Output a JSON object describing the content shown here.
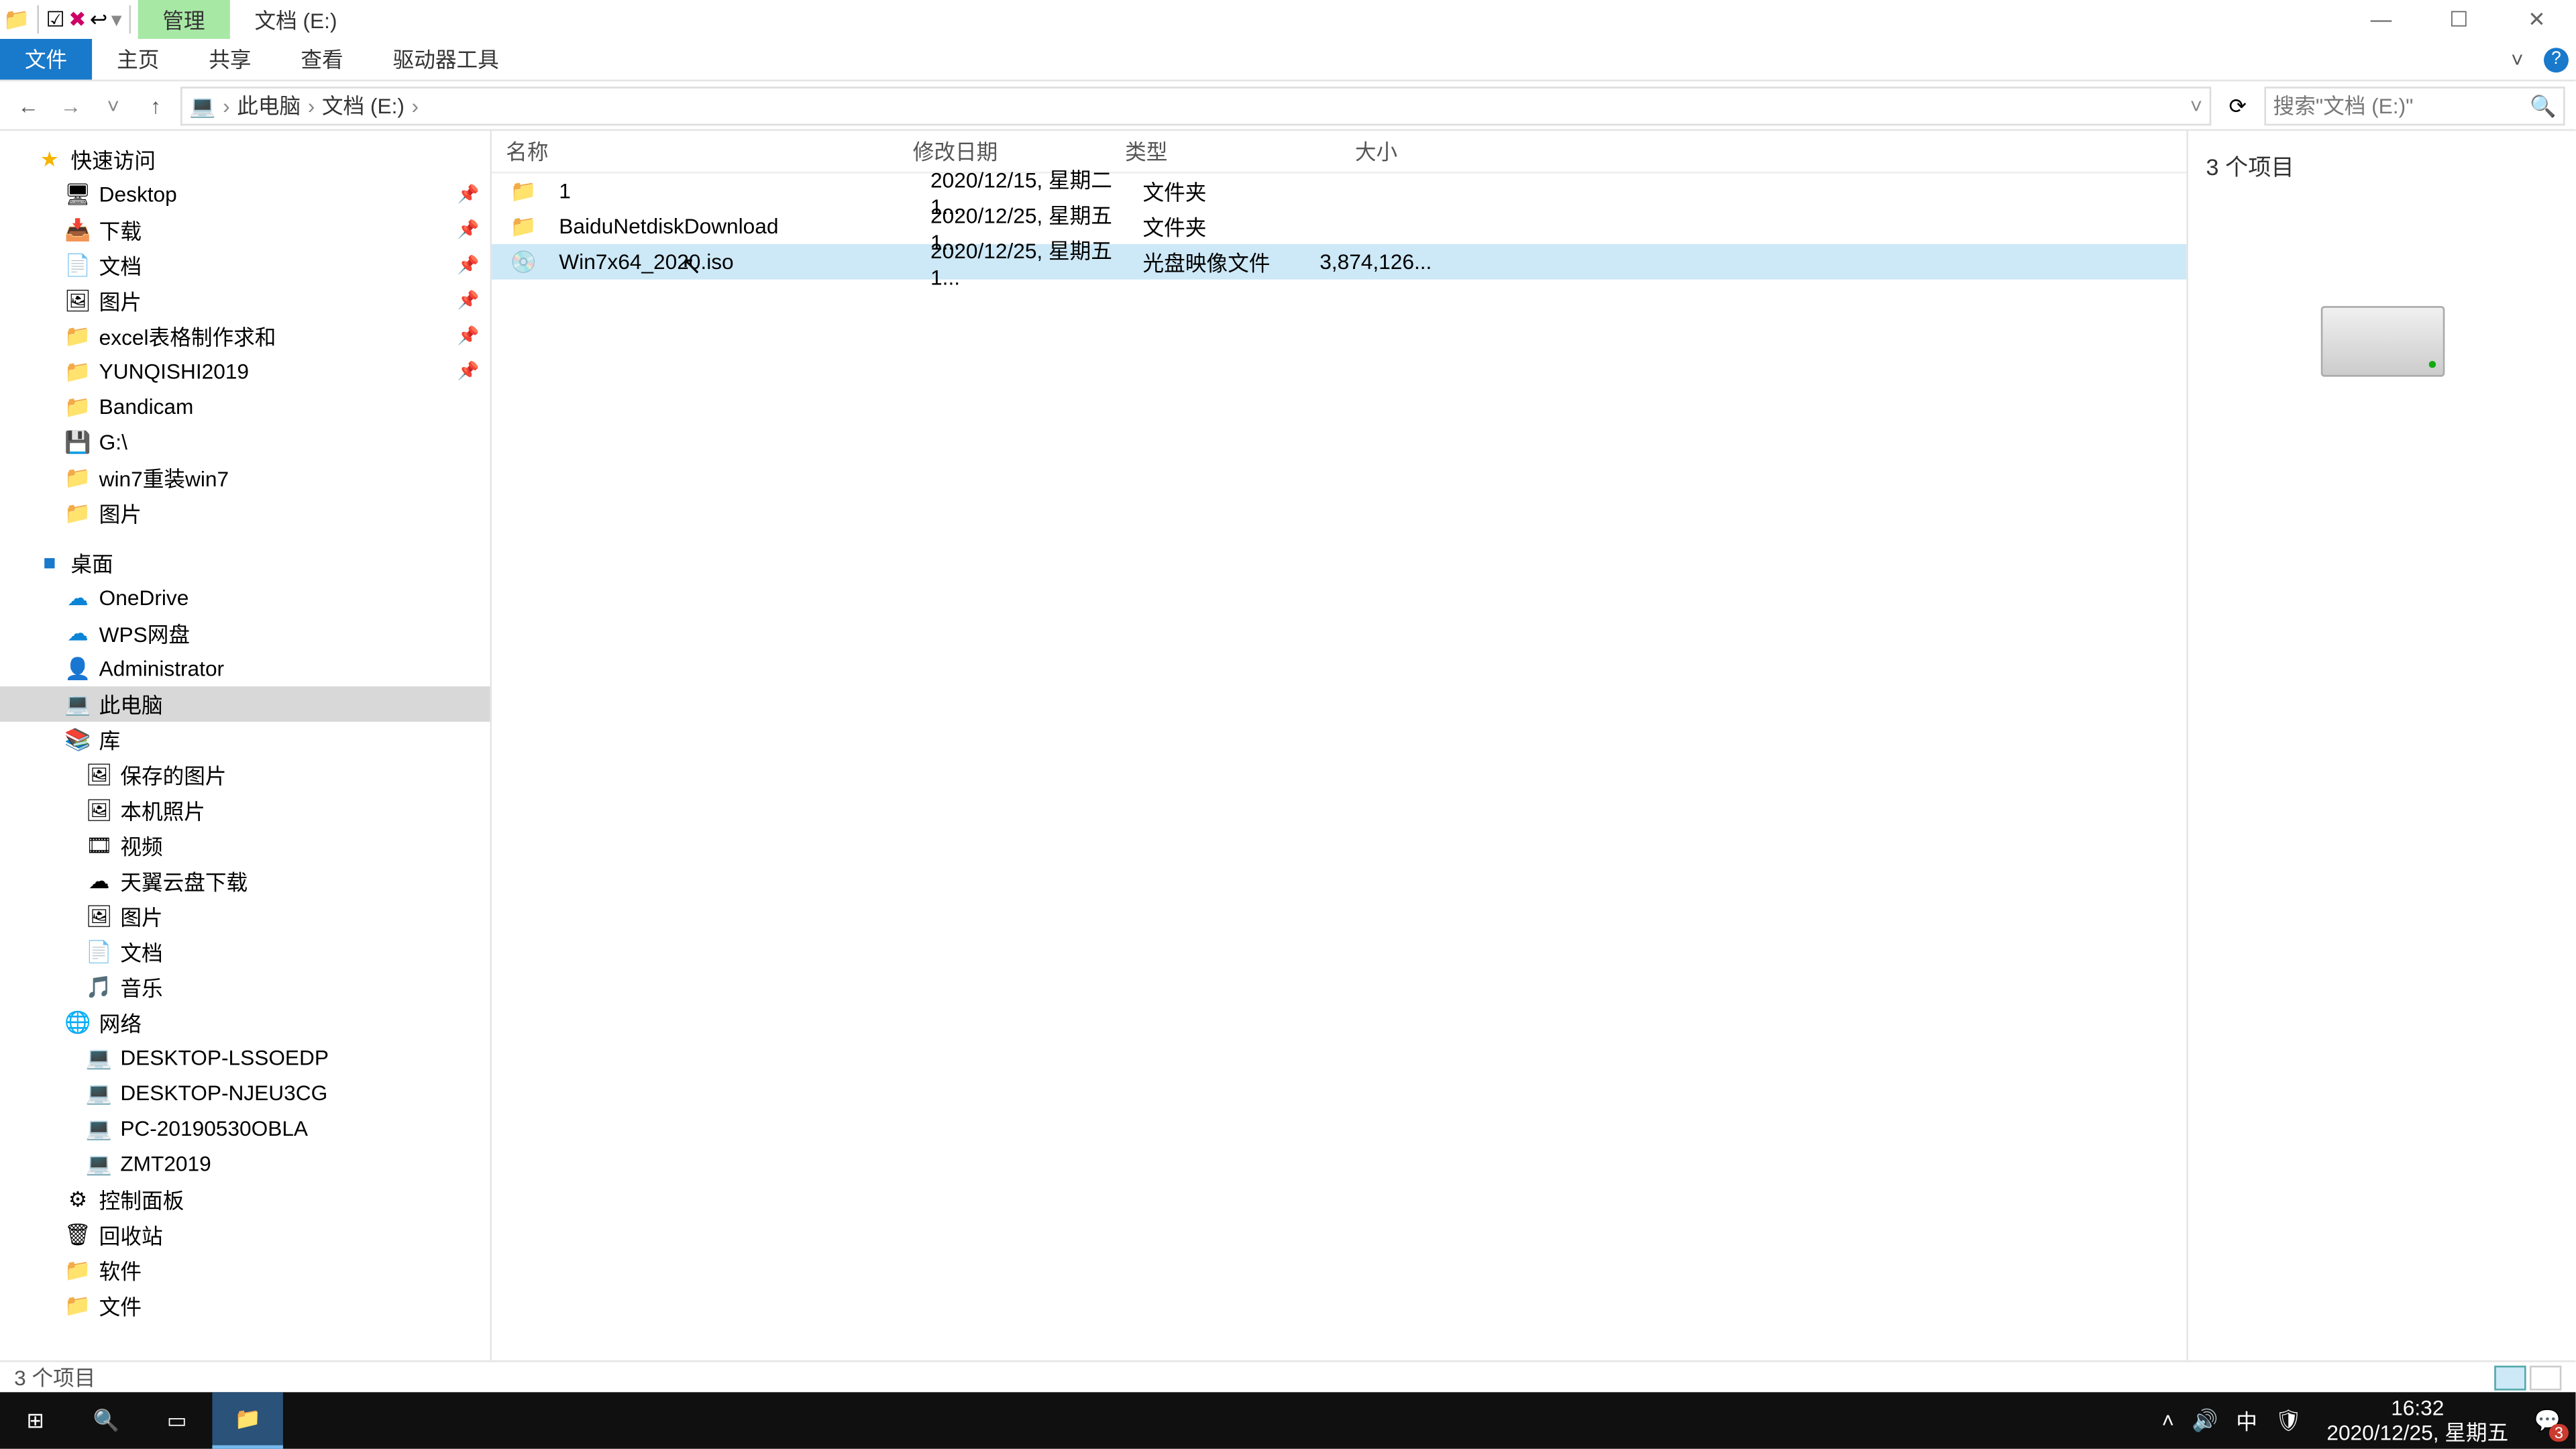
{
  "title": {
    "context_tab": "管理",
    "location_tab": "文档 (E:)"
  },
  "ribbon": {
    "tabs": [
      "文件",
      "主页",
      "共享",
      "查看",
      "驱动器工具"
    ],
    "active": 0
  },
  "address": {
    "crumbs": [
      "此电脑",
      "文档 (E:)"
    ],
    "search_placeholder": "搜索\"文档 (E:)\""
  },
  "tree": {
    "quick": {
      "label": "快速访问",
      "items": [
        {
          "label": "Desktop",
          "icon": "🖥",
          "pinned": true
        },
        {
          "label": "下载",
          "icon": "📥",
          "pinned": true
        },
        {
          "label": "文档",
          "icon": "📄",
          "pinned": true
        },
        {
          "label": "图片",
          "icon": "🖼",
          "pinned": true
        },
        {
          "label": "excel表格制作求和",
          "icon": "📁",
          "pinned": true
        },
        {
          "label": "YUNQISHI2019",
          "icon": "📁",
          "pinned": true
        },
        {
          "label": "Bandicam",
          "icon": "📁"
        },
        {
          "label": "G:\\",
          "icon": "💾"
        },
        {
          "label": "win7重装win7",
          "icon": "📁"
        },
        {
          "label": "图片",
          "icon": "📁"
        }
      ]
    },
    "desktop": {
      "label": "桌面",
      "items": [
        {
          "label": "OneDrive",
          "icon": "☁"
        },
        {
          "label": "WPS网盘",
          "icon": "☁"
        },
        {
          "label": "Administrator",
          "icon": "👤"
        },
        {
          "label": "此电脑",
          "icon": "💻",
          "selected": true
        },
        {
          "label": "库",
          "icon": "📚",
          "children": [
            {
              "label": "保存的图片",
              "icon": "🖼"
            },
            {
              "label": "本机照片",
              "icon": "🖼"
            },
            {
              "label": "视频",
              "icon": "🎞"
            },
            {
              "label": "天翼云盘下载",
              "icon": "☁"
            },
            {
              "label": "图片",
              "icon": "🖼"
            },
            {
              "label": "文档",
              "icon": "📄"
            },
            {
              "label": "音乐",
              "icon": "🎵"
            }
          ]
        },
        {
          "label": "网络",
          "icon": "🌐",
          "children": [
            {
              "label": "DESKTOP-LSSOEDP",
              "icon": "💻"
            },
            {
              "label": "DESKTOP-NJEU3CG",
              "icon": "💻"
            },
            {
              "label": "PC-20190530OBLA",
              "icon": "💻"
            },
            {
              "label": "ZMT2019",
              "icon": "💻"
            }
          ]
        },
        {
          "label": "控制面板",
          "icon": "⚙"
        },
        {
          "label": "回收站",
          "icon": "🗑"
        },
        {
          "label": "软件",
          "icon": "📁"
        },
        {
          "label": "文件",
          "icon": "📁"
        }
      ]
    }
  },
  "columns": {
    "name": "名称",
    "date": "修改日期",
    "type": "类型",
    "size": "大小"
  },
  "rows": [
    {
      "icon": "📁",
      "name": "1",
      "date": "2020/12/15, 星期二 1...",
      "type": "文件夹",
      "size": ""
    },
    {
      "icon": "📁",
      "name": "BaiduNetdiskDownload",
      "date": "2020/12/25, 星期五 1...",
      "type": "文件夹",
      "size": ""
    },
    {
      "icon": "💿",
      "name": "Win7x64_2020.iso",
      "date": "2020/12/25, 星期五 1...",
      "type": "光盘映像文件",
      "size": "3,874,126...",
      "selected": true
    }
  ],
  "preview": {
    "count": "3 个项目"
  },
  "status": {
    "text": "3 个项目"
  },
  "taskbar": {
    "time": "16:32",
    "date": "2020/12/25, 星期五",
    "ime": "中",
    "notif_badge": "3"
  }
}
